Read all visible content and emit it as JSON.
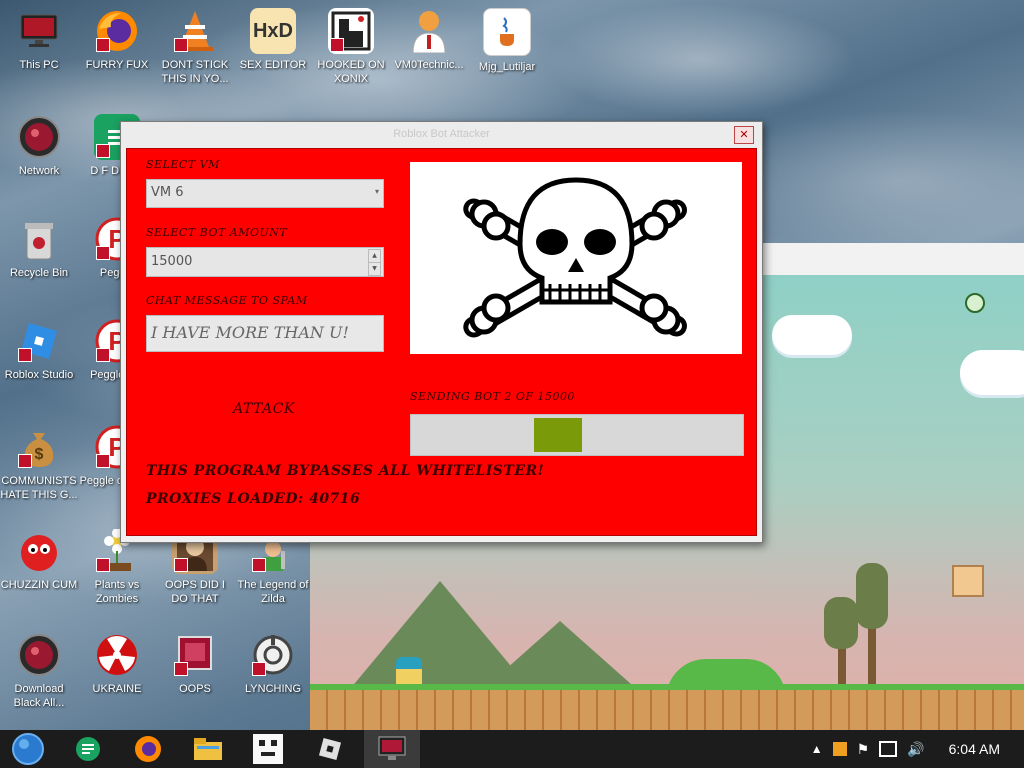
{
  "desktop_icons": [
    {
      "id": "this-pc",
      "label": "This PC",
      "icon": "monitor-icon",
      "color": "#2a2a2a"
    },
    {
      "id": "furry-fux",
      "label": "FURRY FUX",
      "icon": "firefox-icon",
      "color": "#e66000"
    },
    {
      "id": "dont-stick",
      "label": "DONT STICK THIS IN YO...",
      "icon": "traffic-cone-icon",
      "color": "#f08020"
    },
    {
      "id": "sex-editor",
      "label": "SEX EDITOR",
      "icon": "hxd-icon",
      "color": "#f2c04a"
    },
    {
      "id": "hooked-on-xonix",
      "label": "HOOKED ON XONIX",
      "icon": "xonix-icon",
      "color": "#222222"
    },
    {
      "id": "vm0technic",
      "label": "VM0Technic...",
      "icon": "doctor-icon",
      "color": "#f0a040"
    },
    {
      "id": "mjg-lutiljar",
      "label": "Mjg_Lutiljar",
      "icon": "java-icon",
      "color": "#ffffff"
    },
    {
      "id": "network",
      "label": "Network",
      "icon": "network-orb-icon",
      "color": "#8a1020"
    },
    {
      "id": "d-fo-dumb",
      "label": "D F DUMB",
      "icon": "sheets-icon",
      "color": "#1aa261"
    },
    {
      "id": "recycle-bin",
      "label": "Recycle Bin",
      "icon": "recycle-bin-icon",
      "color": "#c0c0c0"
    },
    {
      "id": "peggle",
      "label": "Peggle",
      "icon": "peggle-icon",
      "color": "#d02020"
    },
    {
      "id": "roblox-studio",
      "label": "Roblox Studio",
      "icon": "roblox-studio-icon",
      "color": "#2f8de4"
    },
    {
      "id": "peggle-deluxe",
      "label": "Peggle Del",
      "icon": "peggle-icon",
      "color": "#d02020"
    },
    {
      "id": "communists",
      "label": "COMMUNISTS HATE THIS G...",
      "icon": "money-bag-icon",
      "color": "#c89040"
    },
    {
      "id": "peggle-wars",
      "label": "Peggle of Warc",
      "icon": "peggle-icon",
      "color": "#d02020"
    },
    {
      "id": "chuzzin-cum",
      "label": "CHUZZIN CUM",
      "icon": "chuzzle-icon",
      "color": "#e02020"
    },
    {
      "id": "plants-zombies",
      "label": "Plants vs Zombies",
      "icon": "flower-icon",
      "color": "#f0f0f0"
    },
    {
      "id": "oops-did-i",
      "label": "OOPS DID I DO THAT",
      "icon": "portrait-icon",
      "color": "#c8a070"
    },
    {
      "id": "legend-zilda",
      "label": "The Legend of Zilda",
      "icon": "link-icon",
      "color": "#40a040"
    },
    {
      "id": "download-black",
      "label": "Download Black All...",
      "icon": "network-orb-icon",
      "color": "#8a1020"
    },
    {
      "id": "ukraine",
      "label": "UKRAINE",
      "icon": "radiation-icon",
      "color": "#d01010"
    },
    {
      "id": "oops",
      "label": "OOPS",
      "icon": "screen-icon",
      "color": "#a01030"
    },
    {
      "id": "lynching",
      "label": "LYNCHING",
      "icon": "scp-icon",
      "color": "#f0f0f0"
    }
  ],
  "dialog": {
    "title": "Roblox Bot Attacker",
    "close_glyph": "✕",
    "select_vm_label": "SELECT VM",
    "select_vm_value": "VM 6",
    "bot_amount_label": "SELECT BOT AMOUNT",
    "bot_amount_value": "15000",
    "chat_label": "CHAT MESSAGE TO SPAM",
    "chat_value": "I HAVE MORE THAN U!",
    "attack_label": "ATTACK",
    "status_text": "SENDING BOT 2 OF 15000",
    "progress_fraction": 0.00013,
    "bypass_text": "THIS PROGRAM BYPASSES ALL WHITELISTER!",
    "proxies_text": "PROXIES LOADED: 40716",
    "image_icon": "skull-crossbones-icon"
  },
  "taskbar": {
    "time": "6:04 AM",
    "items": [
      "start-orb-icon",
      "sheets-icon",
      "firefox-icon",
      "file-explorer-icon",
      "pixel-game-icon",
      "roblox-icon",
      "vm-screen-icon"
    ]
  },
  "colors": {
    "dialog_bg": "#ff0000",
    "progress_chunk": "#7a9a0a"
  }
}
